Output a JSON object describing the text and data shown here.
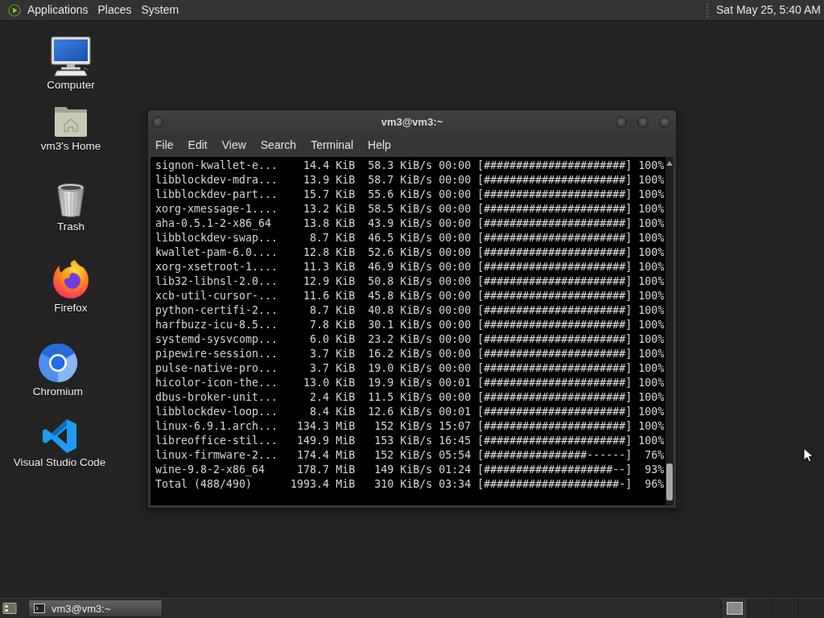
{
  "top_panel": {
    "menus": [
      {
        "label": "Applications"
      },
      {
        "label": "Places"
      },
      {
        "label": "System"
      }
    ],
    "clock": "Sat May 25, 5:40 AM"
  },
  "desktop_icons": [
    {
      "label": "Computer",
      "kind": "computer"
    },
    {
      "label": "vm3's Home",
      "kind": "home"
    },
    {
      "label": "Trash",
      "kind": "trash"
    },
    {
      "label": "Firefox",
      "kind": "firefox"
    },
    {
      "label": "Chromium",
      "kind": "chromium"
    },
    {
      "label": "Visual Studio Code",
      "kind": "vscode"
    }
  ],
  "terminal_window": {
    "title": "vm3@vm3:~",
    "menu": [
      {
        "label": "File"
      },
      {
        "label": "Edit"
      },
      {
        "label": "View"
      },
      {
        "label": "Search"
      },
      {
        "label": "Terminal"
      },
      {
        "label": "Help"
      }
    ],
    "lines": [
      {
        "name": "signon-kwallet-e...",
        "size": "14.4 KiB",
        "rate": "58.3 KiB/s",
        "time": "00:00",
        "bar": "[######################]",
        "percent": "100%"
      },
      {
        "name": "libblockdev-mdra...",
        "size": "13.9 KiB",
        "rate": "58.7 KiB/s",
        "time": "00:00",
        "bar": "[######################]",
        "percent": "100%"
      },
      {
        "name": "libblockdev-part...",
        "size": "15.7 KiB",
        "rate": "55.6 KiB/s",
        "time": "00:00",
        "bar": "[######################]",
        "percent": "100%"
      },
      {
        "name": "xorg-xmessage-1....",
        "size": "13.2 KiB",
        "rate": "58.5 KiB/s",
        "time": "00:00",
        "bar": "[######################]",
        "percent": "100%"
      },
      {
        "name": "aha-0.5.1-2-x86_64",
        "size": "13.8 KiB",
        "rate": "43.9 KiB/s",
        "time": "00:00",
        "bar": "[######################]",
        "percent": "100%"
      },
      {
        "name": "libblockdev-swap...",
        "size": "8.7 KiB",
        "rate": "46.5 KiB/s",
        "time": "00:00",
        "bar": "[######################]",
        "percent": "100%"
      },
      {
        "name": "kwallet-pam-6.0....",
        "size": "12.8 KiB",
        "rate": "52.6 KiB/s",
        "time": "00:00",
        "bar": "[######################]",
        "percent": "100%"
      },
      {
        "name": "xorg-xsetroot-1....",
        "size": "11.3 KiB",
        "rate": "46.9 KiB/s",
        "time": "00:00",
        "bar": "[######################]",
        "percent": "100%"
      },
      {
        "name": "lib32-libnsl-2.0...",
        "size": "12.9 KiB",
        "rate": "50.8 KiB/s",
        "time": "00:00",
        "bar": "[######################]",
        "percent": "100%"
      },
      {
        "name": "xcb-util-cursor-...",
        "size": "11.6 KiB",
        "rate": "45.8 KiB/s",
        "time": "00:00",
        "bar": "[######################]",
        "percent": "100%"
      },
      {
        "name": "python-certifi-2...",
        "size": "8.7 KiB",
        "rate": "40.8 KiB/s",
        "time": "00:00",
        "bar": "[######################]",
        "percent": "100%"
      },
      {
        "name": "harfbuzz-icu-8.5...",
        "size": "7.8 KiB",
        "rate": "30.1 KiB/s",
        "time": "00:00",
        "bar": "[######################]",
        "percent": "100%"
      },
      {
        "name": "systemd-sysvcomp...",
        "size": "6.0 KiB",
        "rate": "23.2 KiB/s",
        "time": "00:00",
        "bar": "[######################]",
        "percent": "100%"
      },
      {
        "name": "pipewire-session...",
        "size": "3.7 KiB",
        "rate": "16.2 KiB/s",
        "time": "00:00",
        "bar": "[######################]",
        "percent": "100%"
      },
      {
        "name": "pulse-native-pro...",
        "size": "3.7 KiB",
        "rate": "19.0 KiB/s",
        "time": "00:00",
        "bar": "[######################]",
        "percent": "100%"
      },
      {
        "name": "hicolor-icon-the...",
        "size": "13.0 KiB",
        "rate": "19.9 KiB/s",
        "time": "00:01",
        "bar": "[######################]",
        "percent": "100%"
      },
      {
        "name": "dbus-broker-unit...",
        "size": "2.4 KiB",
        "rate": "11.5 KiB/s",
        "time": "00:00",
        "bar": "[######################]",
        "percent": "100%"
      },
      {
        "name": "libblockdev-loop...",
        "size": "8.4 KiB",
        "rate": "12.6 KiB/s",
        "time": "00:01",
        "bar": "[######################]",
        "percent": "100%"
      },
      {
        "name": "linux-6.9.1.arch...",
        "size": "134.3 MiB",
        "rate": "152 KiB/s",
        "time": "15:07",
        "bar": "[######################]",
        "percent": "100%"
      },
      {
        "name": "libreoffice-stil...",
        "size": "149.9 MiB",
        "rate": "153 KiB/s",
        "time": "16:45",
        "bar": "[######################]",
        "percent": "100%"
      },
      {
        "name": "linux-firmware-2...",
        "size": "174.4 MiB",
        "rate": "152 KiB/s",
        "time": "05:54",
        "bar": "[################------]",
        "percent": "76%"
      },
      {
        "name": "wine-9.8-2-x86_64",
        "size": "178.7 MiB",
        "rate": "149 KiB/s",
        "time": "01:24",
        "bar": "[####################--]",
        "percent": "93%"
      },
      {
        "name": "Total (488/490)",
        "size": "1993.4 MiB",
        "rate": "310 KiB/s",
        "time": "03:34",
        "bar": "[#####################-]",
        "percent": "96%"
      }
    ]
  },
  "taskbar": {
    "tasks": [
      {
        "label": "vm3@vm3:~",
        "selected": true
      }
    ],
    "workspaces": [
      {
        "selected": true
      },
      {
        "selected": false
      },
      {
        "selected": false
      },
      {
        "selected": false
      }
    ]
  }
}
